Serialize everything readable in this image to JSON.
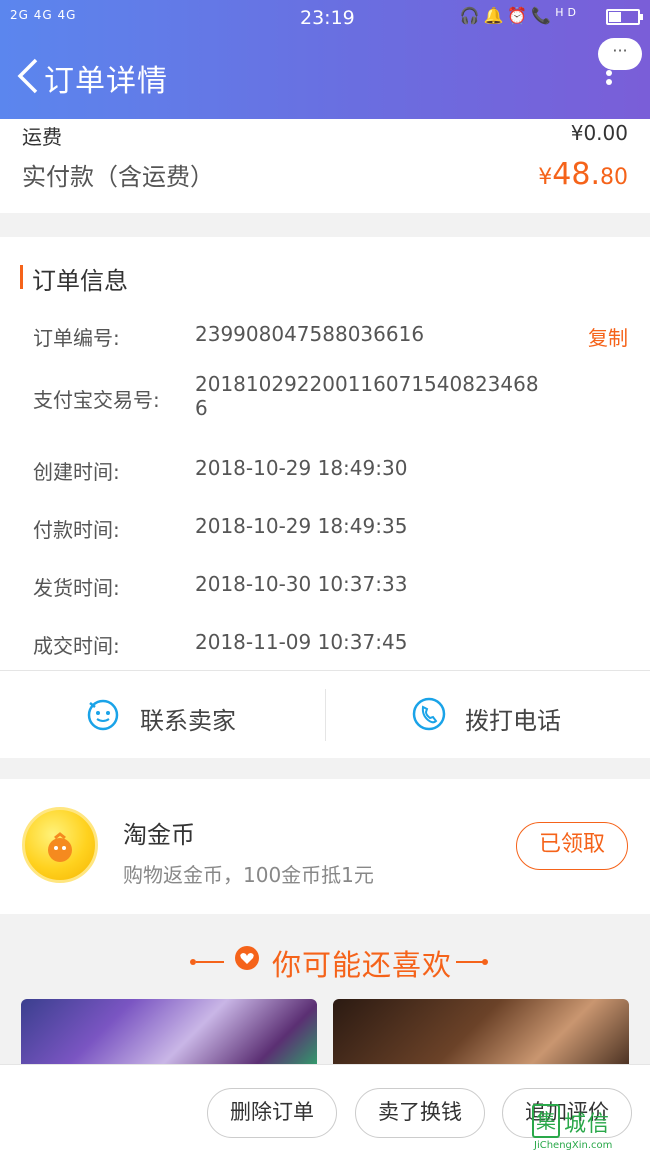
{
  "status_bar": {
    "signal": "2G 4G 4G",
    "time": "23:19",
    "hd_label": "HD"
  },
  "header": {
    "title": "订单详情",
    "more_label": "···"
  },
  "fee": {
    "shipping_label": "运费",
    "shipping_value": "¥0.00",
    "paid_label": "实付款（含运费）",
    "paid_currency": "¥",
    "paid_integer": "48.",
    "paid_decimal": "80"
  },
  "order_info": {
    "title": "订单信息",
    "copy_label": "复制",
    "rows": [
      {
        "label": "订单编号:",
        "value": "239908047588036616"
      },
      {
        "label": "支付宝交易号:",
        "value": "20181029220011607154082346​86"
      },
      {
        "label": "创建时间:",
        "value": "2018-10-29 18:49:30"
      },
      {
        "label": "付款时间:",
        "value": "2018-10-29 18:49:35"
      },
      {
        "label": "发货时间:",
        "value": "2018-10-30 10:37:33"
      },
      {
        "label": "成交时间:",
        "value": "2018-11-09 10:37:45"
      }
    ]
  },
  "contact": {
    "seller_label": "联系卖家",
    "call_label": "拨打电话"
  },
  "coin": {
    "title": "淘金币",
    "desc": "购物返金币，100金币抵1元",
    "button": "已领取"
  },
  "recommend": {
    "title": "你可能还喜欢"
  },
  "bottom_bar": {
    "delete": "删除订单",
    "resell": "卖了换钱",
    "review": "追加评价"
  },
  "watermark": {
    "mark": "集",
    "text": "城信",
    "sub": "JiChengXin.com"
  },
  "colors": {
    "accent": "#f5631a",
    "header_start": "#5b86ee",
    "header_end": "#7a5ed8",
    "contact_icon": "#1aa3e8"
  }
}
